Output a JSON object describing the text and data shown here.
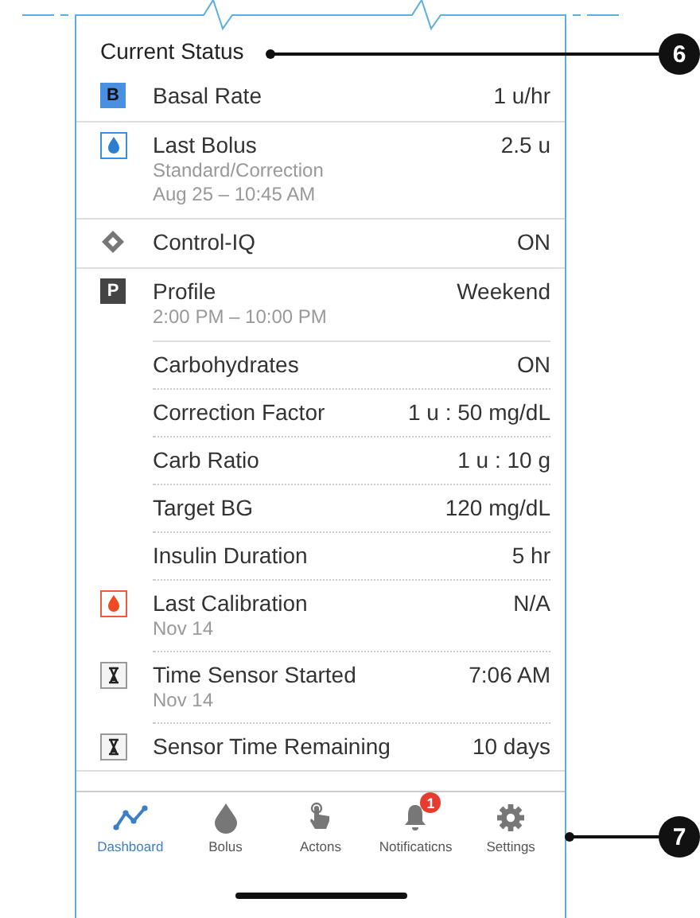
{
  "section_title": "Current Status",
  "groups": [
    {
      "items": [
        {
          "kind": "basal",
          "badge": "B",
          "label": "Basal Rate",
          "value": "1 u/hr"
        }
      ]
    },
    {
      "items": [
        {
          "kind": "bolus",
          "label": "Last Bolus",
          "value": "2.5 u",
          "details": [
            "Standard/Correction",
            "Aug 25 – 10:45 AM"
          ]
        }
      ]
    },
    {
      "items": [
        {
          "kind": "control",
          "label": "Control-IQ",
          "value": "ON"
        }
      ]
    },
    {
      "items": [
        {
          "kind": "profile",
          "badge": "P",
          "label": "Profile",
          "value": "Weekend",
          "details": [
            "2:00 PM – 10:00 PM"
          ]
        },
        {
          "kind": "none",
          "label": "Carbohydrates",
          "value": "ON"
        },
        {
          "kind": "none",
          "label": "Correction Factor",
          "value": "1 u : 50 mg/dL"
        },
        {
          "kind": "none",
          "label": "Carb Ratio",
          "value": "1 u : 10 g"
        },
        {
          "kind": "none",
          "label": "Target BG",
          "value": "120 mg/dL"
        },
        {
          "kind": "none",
          "label": "Insulin Duration",
          "value": "5 hr"
        },
        {
          "kind": "calibration",
          "label": "Last Calibration",
          "value": "N/A",
          "details": [
            "Nov 14"
          ]
        },
        {
          "kind": "hourglass",
          "label": "Time Sensor Started",
          "value": "7:06 AM",
          "details": [
            "Nov 14"
          ]
        },
        {
          "kind": "hourglass",
          "label": "Sensor Time Remaining",
          "value": "10 days"
        }
      ]
    }
  ],
  "nav": [
    {
      "kind": "dashboard",
      "label": "Dashboard",
      "selected": true
    },
    {
      "kind": "bolus",
      "label": "Bolus",
      "selected": false
    },
    {
      "kind": "actions",
      "label": "Actons",
      "selected": false
    },
    {
      "kind": "notifications",
      "label": "Notificaticns",
      "selected": false,
      "badge": "1"
    },
    {
      "kind": "settings",
      "label": "Settings",
      "selected": false
    }
  ],
  "callouts": [
    "6",
    "7"
  ]
}
